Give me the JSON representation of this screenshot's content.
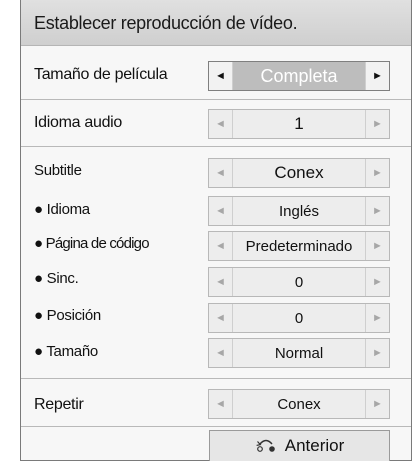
{
  "title": "Establecer reproducción de vídeo.",
  "rows": [
    {
      "label": "Tamaño de película",
      "value": "Completa",
      "state": "active"
    },
    {
      "label": "Idioma audio",
      "value": "1",
      "state": "normal"
    },
    {
      "label": "Subtitle",
      "value": "Conex",
      "state": "normal"
    },
    {
      "label": "● Idioma",
      "value": "Inglés",
      "state": "normal"
    },
    {
      "label": "● Página de código",
      "value": "Predeterminado",
      "state": "normal"
    },
    {
      "label": "● Sinc.",
      "value": "0",
      "state": "normal"
    },
    {
      "label": "● Posición",
      "value": "0",
      "state": "normal"
    },
    {
      "label": "● Tamaño",
      "value": "Normal",
      "state": "normal"
    },
    {
      "label": "Repetir",
      "value": "Conex",
      "state": "normal"
    }
  ],
  "arrows": {
    "left": "◄",
    "right": "►"
  },
  "back_button": {
    "label": "Anterior",
    "icon": "return-arrow-icon"
  }
}
